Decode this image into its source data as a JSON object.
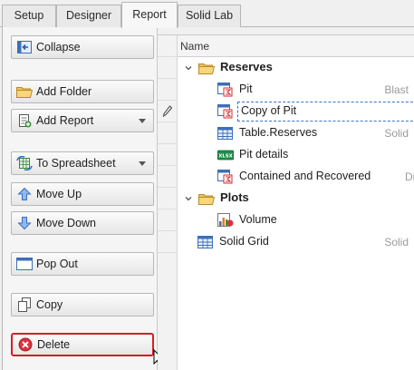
{
  "tabs": [
    {
      "label": "Setup"
    },
    {
      "label": "Designer"
    },
    {
      "label": "Report"
    },
    {
      "label": "Solid Lab"
    }
  ],
  "active_tab": "Report",
  "buttons": {
    "collapse": "Collapse",
    "add_folder": "Add Folder",
    "add_report": "Add Report",
    "to_spreadsheet": "To Spreadsheet",
    "move_up": "Move Up",
    "move_down": "Move Down",
    "pop_out": "Pop Out",
    "copy": "Copy",
    "delete": "Delete"
  },
  "grid": {
    "header": "Name",
    "rows": [
      {
        "label": "Reserves",
        "type": "",
        "kind": "folder"
      },
      {
        "label": "Pit",
        "type": "Blast",
        "kind": "report"
      },
      {
        "label": "Copy of Pit",
        "type": "",
        "kind": "report",
        "selected": true
      },
      {
        "label": "Table.Reserves",
        "type": "Solid",
        "kind": "table"
      },
      {
        "label": "Pit details",
        "type": "",
        "kind": "xlsx"
      },
      {
        "label": "Contained and Recovered",
        "type": "Dig",
        "kind": "report"
      },
      {
        "label": "Plots",
        "type": "",
        "kind": "folder"
      },
      {
        "label": "Volume",
        "type": "",
        "kind": "chart"
      },
      {
        "label": "Solid Grid",
        "type": "Solid",
        "kind": "table"
      }
    ]
  },
  "icons": {
    "collapse": "collapse-icon",
    "add_folder": "folder-icon",
    "add_report": "add-report-icon",
    "to_spreadsheet": "spreadsheet-icon",
    "move_up": "arrow-up-icon",
    "move_down": "arrow-down-icon",
    "pop_out": "window-icon",
    "copy": "copy-icon",
    "delete": "delete-icon",
    "edit_indicator": "pencil-icon",
    "xlsx_badge": "XLSX"
  },
  "colors": {
    "delete_highlight": "#d21f2a",
    "selection": "#3c74c8",
    "folder": "#e9b64a",
    "type_text": "#9a9a9a"
  }
}
